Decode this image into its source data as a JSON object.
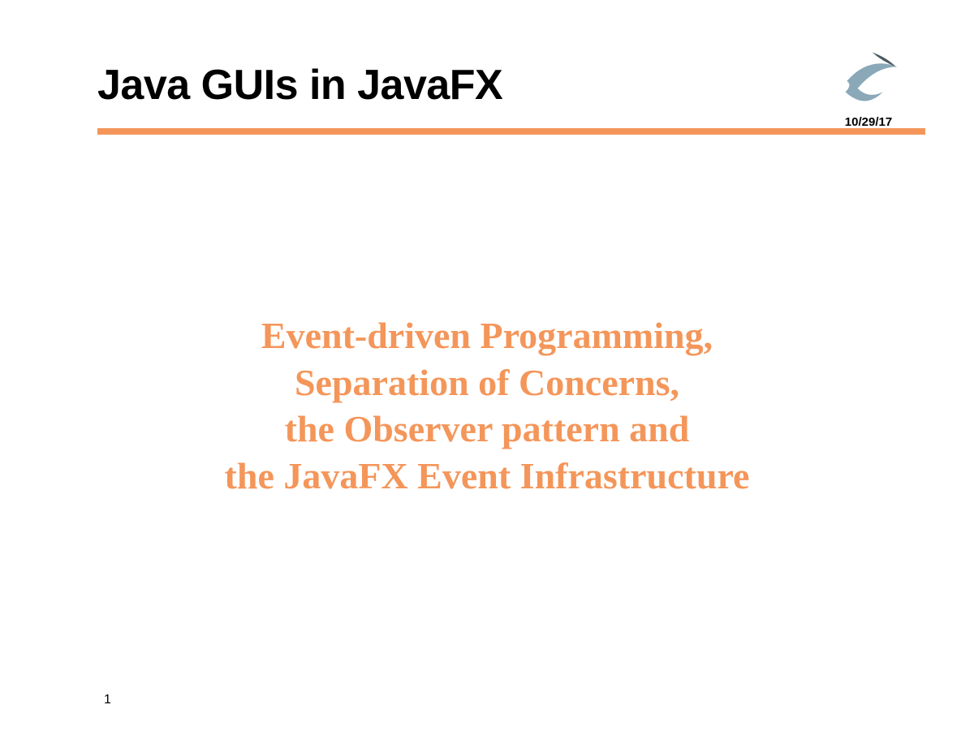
{
  "header": {
    "title": "Java GUIs in JavaFX",
    "date": "10/29/17"
  },
  "subtitle": {
    "line1": "Event-driven Programming,",
    "line2": "Separation of Concerns,",
    "line3": "the Observer pattern and",
    "line4": "the JavaFX Event Infrastructure"
  },
  "page_number": "1",
  "colors": {
    "accent": "#f4965a"
  }
}
